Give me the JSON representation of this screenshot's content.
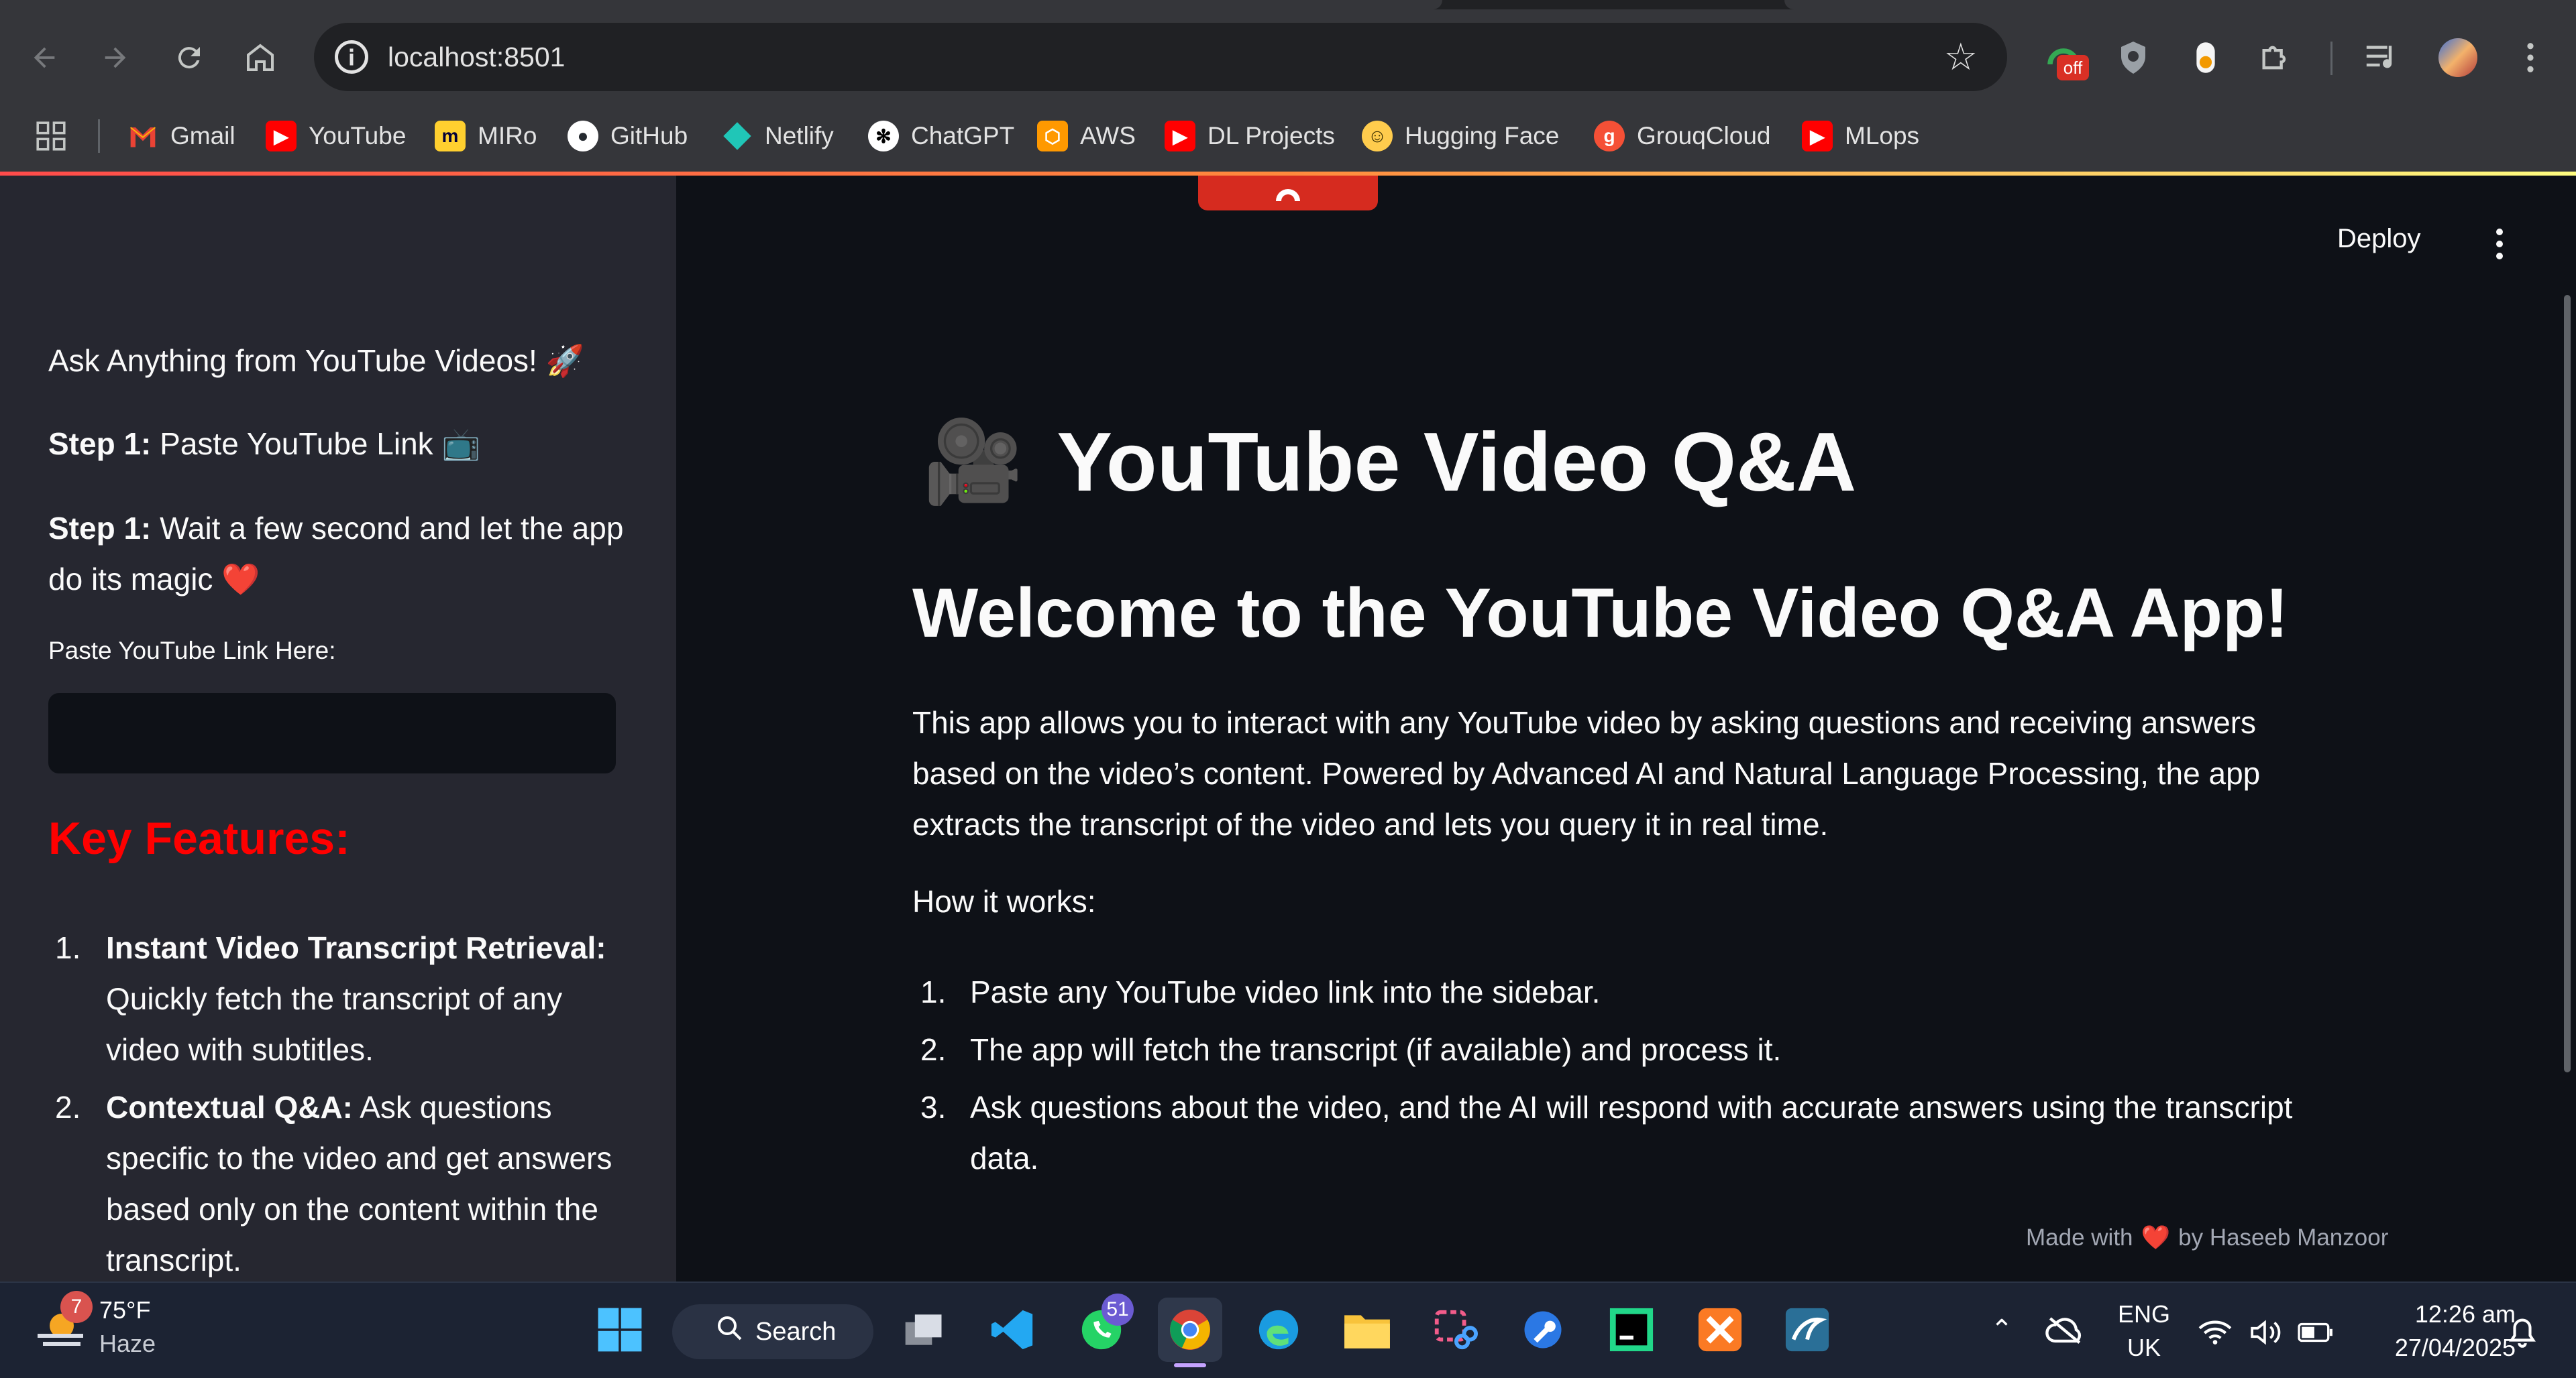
{
  "browser": {
    "url": "localhost:8501",
    "bookmarks": [
      "Gmail",
      "YouTube",
      "MIRo",
      "GitHub",
      "Netlify",
      "ChatGPT",
      "AWS",
      "DL Projects",
      "Hugging Face",
      "GrouqCloud",
      "MLops"
    ],
    "extension_badge": "off",
    "icons": {
      "back": "back-arrow-icon",
      "forward": "forward-arrow-icon",
      "reload": "reload-icon",
      "home": "home-icon",
      "site_info": "info-icon",
      "bookmark": "star-icon",
      "apps": "apps-grid-icon"
    }
  },
  "app": {
    "deploy_label": "Deploy",
    "title_emoji": "🎥",
    "title": "YouTube Video Q&A",
    "welcome_heading": "Welcome to the YouTube Video Q&A App!",
    "intro_paragraph": "This app allows you to interact with any YouTube video by asking questions and receiving answers based on the video’s content. Powered by Advanced AI and Natural Language Processing, the app extracts the transcript of the video and lets you query it in real time.",
    "how_label": "How it works:",
    "how_steps": [
      "Paste any YouTube video link into the sidebar.",
      "The app will fetch the transcript (if available) and process it.",
      "Ask questions about the video, and the AI will respond with accurate answers using the transcript data."
    ],
    "footer_prefix": "Made with",
    "footer_heart": "❤️",
    "footer_suffix": "by Haseeb Manzoor"
  },
  "sidebar": {
    "tagline": "Ask Anything from YouTube Videos! 🚀",
    "step1_bold": "Step 1:",
    "step1_text": " Paste YouTube Link 📺",
    "step2_bold": "Step 1:",
    "step2_text": " Wait a few second and let the app do its magic ❤️",
    "input_label": "Paste YouTube Link Here:",
    "input_value": "",
    "features_heading": "Key Features:",
    "features": [
      {
        "bold": "Instant Video Transcript Retrieval:",
        "text": " Quickly fetch the transcript of any video with subtitles."
      },
      {
        "bold": "Contextual Q&A:",
        "text": " Ask questions specific to the video and get answers based only on the content within the transcript."
      }
    ]
  },
  "taskbar": {
    "weather_temp": "75°F",
    "weather_desc": "Haze",
    "weather_badge": "7",
    "search_label": "Search",
    "whatsapp_badge": "51",
    "lang_line1": "ENG",
    "lang_line2": "UK",
    "time": "12:26 am",
    "date": "27/04/2025"
  },
  "colors": {
    "sidebar_bg": "#262730",
    "main_bg": "#0e1117",
    "accent_red": "#ff0000",
    "chrome_bg": "#35363a"
  }
}
